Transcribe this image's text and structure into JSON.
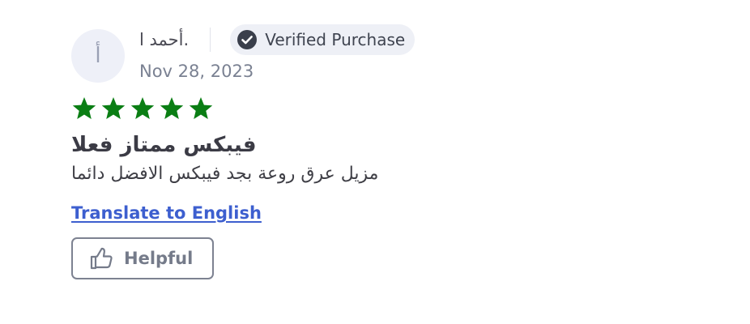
{
  "review": {
    "avatar_initial": "أ",
    "author_name": "أحمد ا.",
    "verified_label": "Verified Purchase",
    "date": "Nov 28, 2023",
    "rating": 5,
    "rating_max": 5,
    "star_color": "#0a7e14",
    "title": "فيبكس ممتاز فعلا",
    "body": "مزيل عرق روعة بجد فيبكس الافضل دائما",
    "translate_label": "Translate to English",
    "helpful_label": "Helpful",
    "icons": {
      "verified": "check-circle-icon",
      "star": "star-icon",
      "helpful": "thumbs-up-icon"
    }
  }
}
